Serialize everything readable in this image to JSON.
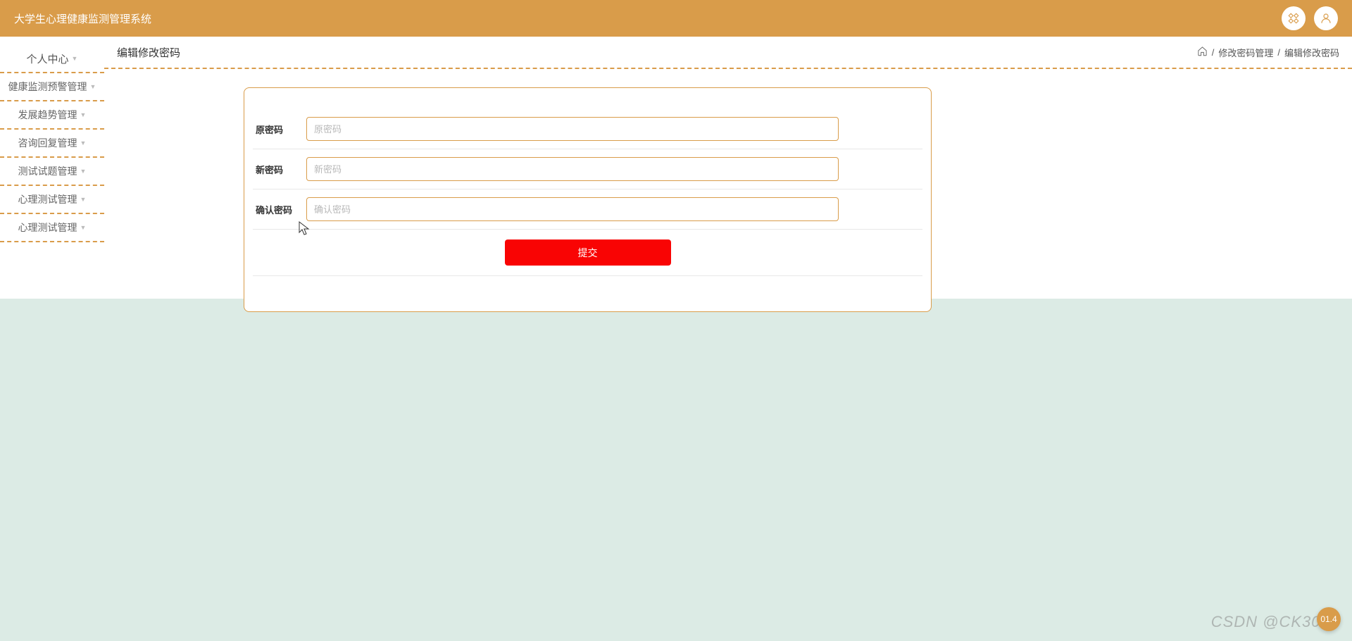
{
  "header": {
    "title": "大学生心理健康监测管理系统"
  },
  "sidebar": {
    "items": [
      {
        "label": "个人中心"
      },
      {
        "label": "健康监测预警管理"
      },
      {
        "label": "发展趋势管理"
      },
      {
        "label": "咨询回复管理"
      },
      {
        "label": "测试试题管理"
      },
      {
        "label": "心理测试管理"
      },
      {
        "label": "心理测试管理"
      }
    ]
  },
  "page": {
    "title": "编辑修改密码"
  },
  "breadcrumb": {
    "sep1": "/",
    "item1": "修改密码管理",
    "sep2": "/",
    "item2": "编辑修改密码"
  },
  "form": {
    "old_password": {
      "label": "原密码",
      "placeholder": "原密码"
    },
    "new_password": {
      "label": "新密码",
      "placeholder": "新密码"
    },
    "confirm_password": {
      "label": "确认密码",
      "placeholder": "确认密码"
    },
    "submit_label": "提交"
  },
  "watermark": "CSDN @CK3040",
  "float_badge": "01.4"
}
